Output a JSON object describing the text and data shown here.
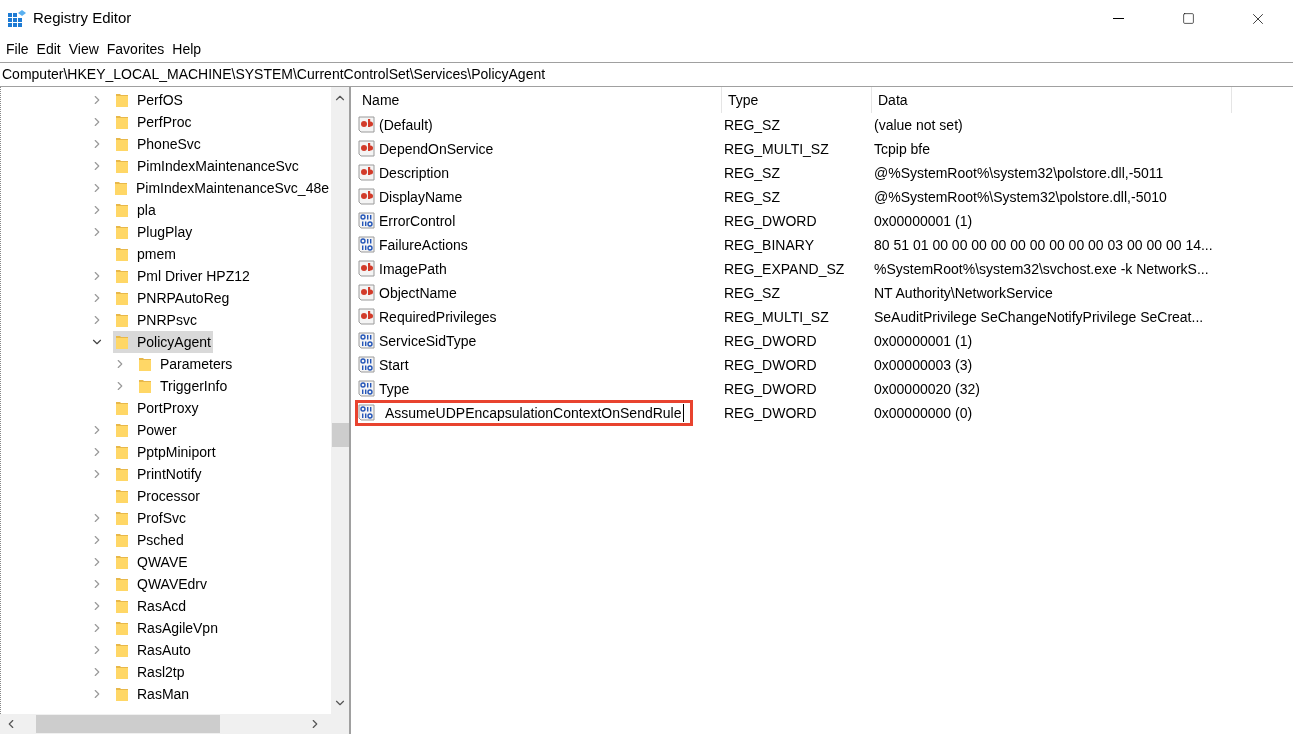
{
  "window": {
    "title": "Registry Editor"
  },
  "menu": [
    "File",
    "Edit",
    "View",
    "Favorites",
    "Help"
  ],
  "address": "Computer\\HKEY_LOCAL_MACHINE\\SYSTEM\\CurrentControlSet\\Services\\PolicyAgent",
  "tree": [
    {
      "label": "PerfOS",
      "expandable": true,
      "expanded": false,
      "selected": false
    },
    {
      "label": "PerfProc",
      "expandable": true,
      "expanded": false,
      "selected": false
    },
    {
      "label": "PhoneSvc",
      "expandable": true,
      "expanded": false,
      "selected": false
    },
    {
      "label": "PimIndexMaintenanceSvc",
      "expandable": true,
      "expanded": false,
      "selected": false
    },
    {
      "label": "PimIndexMaintenanceSvc_48e",
      "expandable": true,
      "expanded": false,
      "selected": false
    },
    {
      "label": "pla",
      "expandable": true,
      "expanded": false,
      "selected": false
    },
    {
      "label": "PlugPlay",
      "expandable": true,
      "expanded": false,
      "selected": false
    },
    {
      "label": "pmem",
      "expandable": false,
      "selected": false
    },
    {
      "label": "Pml Driver HPZ12",
      "expandable": true,
      "expanded": false,
      "selected": false
    },
    {
      "label": "PNRPAutoReg",
      "expandable": true,
      "expanded": false,
      "selected": false
    },
    {
      "label": "PNRPsvc",
      "expandable": true,
      "expanded": false,
      "selected": false
    },
    {
      "label": "PolicyAgent",
      "expandable": true,
      "expanded": true,
      "selected": true,
      "children": [
        {
          "label": "Parameters",
          "expandable": true,
          "expanded": false,
          "selected": false
        },
        {
          "label": "TriggerInfo",
          "expandable": true,
          "expanded": false,
          "selected": false
        }
      ]
    },
    {
      "label": "PortProxy",
      "expandable": false,
      "selected": false
    },
    {
      "label": "Power",
      "expandable": true,
      "expanded": false,
      "selected": false
    },
    {
      "label": "PptpMiniport",
      "expandable": true,
      "expanded": false,
      "selected": false
    },
    {
      "label": "PrintNotify",
      "expandable": true,
      "expanded": false,
      "selected": false
    },
    {
      "label": "Processor",
      "expandable": false,
      "selected": false
    },
    {
      "label": "ProfSvc",
      "expandable": true,
      "expanded": false,
      "selected": false
    },
    {
      "label": "Psched",
      "expandable": true,
      "expanded": false,
      "selected": false
    },
    {
      "label": "QWAVE",
      "expandable": true,
      "expanded": false,
      "selected": false
    },
    {
      "label": "QWAVEdrv",
      "expandable": true,
      "expanded": false,
      "selected": false
    },
    {
      "label": "RasAcd",
      "expandable": true,
      "expanded": false,
      "selected": false
    },
    {
      "label": "RasAgileVpn",
      "expandable": true,
      "expanded": false,
      "selected": false
    },
    {
      "label": "RasAuto",
      "expandable": true,
      "expanded": false,
      "selected": false
    },
    {
      "label": "Rasl2tp",
      "expandable": true,
      "expanded": false,
      "selected": false
    },
    {
      "label": "RasMan",
      "expandable": true,
      "expanded": false,
      "selected": false
    }
  ],
  "table": {
    "columns": [
      "Name",
      "Type",
      "Data"
    ],
    "rows": [
      {
        "kind": "string",
        "name": "(Default)",
        "type": "REG_SZ",
        "data": "(value not set)",
        "editing": false
      },
      {
        "kind": "string",
        "name": "DependOnService",
        "type": "REG_MULTI_SZ",
        "data": "Tcpip bfe",
        "editing": false
      },
      {
        "kind": "string",
        "name": "Description",
        "type": "REG_SZ",
        "data": "@%SystemRoot%\\system32\\polstore.dll,-5011",
        "editing": false
      },
      {
        "kind": "string",
        "name": "DisplayName",
        "type": "REG_SZ",
        "data": "@%SystemRoot%\\System32\\polstore.dll,-5010",
        "editing": false
      },
      {
        "kind": "binary",
        "name": "ErrorControl",
        "type": "REG_DWORD",
        "data": "0x00000001 (1)",
        "editing": false
      },
      {
        "kind": "binary",
        "name": "FailureActions",
        "type": "REG_BINARY",
        "data": "80 51 01 00 00 00 00 00 00 00 00 00 03 00 00 00 14...",
        "editing": false
      },
      {
        "kind": "string",
        "name": "ImagePath",
        "type": "REG_EXPAND_SZ",
        "data": "%SystemRoot%\\system32\\svchost.exe -k NetworkS...",
        "editing": false
      },
      {
        "kind": "string",
        "name": "ObjectName",
        "type": "REG_SZ",
        "data": "NT Authority\\NetworkService",
        "editing": false
      },
      {
        "kind": "string",
        "name": "RequiredPrivileges",
        "type": "REG_MULTI_SZ",
        "data": "SeAuditPrivilege SeChangeNotifyPrivilege SeCreat...",
        "editing": false
      },
      {
        "kind": "binary",
        "name": "ServiceSidType",
        "type": "REG_DWORD",
        "data": "0x00000001 (1)",
        "editing": false
      },
      {
        "kind": "binary",
        "name": "Start",
        "type": "REG_DWORD",
        "data": "0x00000003 (3)",
        "editing": false
      },
      {
        "kind": "binary",
        "name": "Type",
        "type": "REG_DWORD",
        "data": "0x00000020 (32)",
        "editing": false
      },
      {
        "kind": "binary",
        "name": "AssumeUDPEncapsulationContextOnSendRule",
        "type": "REG_DWORD",
        "data": "0x00000000 (0)",
        "editing": true
      }
    ]
  }
}
